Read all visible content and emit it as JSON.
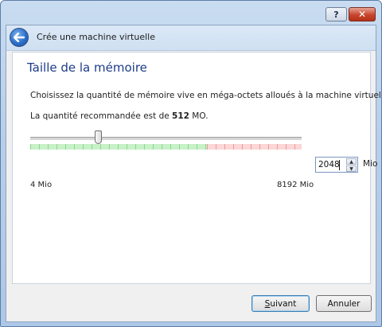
{
  "window": {
    "help_label": "?",
    "close_label": "✕"
  },
  "header": {
    "title": "Crée une machine virtuelle",
    "back_icon": "back-arrow-icon"
  },
  "page": {
    "title": "Taille de la mémoire",
    "description": "Choisissez la quantité de mémoire vive en méga-octets alloués à la machine virtuelle.",
    "recommended_prefix": "La quantité recommandée est de ",
    "recommended_value": "512",
    "recommended_suffix": " MO."
  },
  "memory": {
    "value": "2048",
    "unit": "Mio",
    "min_label": "4 Mio",
    "max_label": "8192 Mio",
    "slider_level": 0.25,
    "recommended_limit_fraction": 0.65,
    "zone_colors": {
      "ok": "#8bd98b",
      "warn": "#f19a9a"
    }
  },
  "buttons": {
    "next_first": "S",
    "next_rest": "uivant",
    "cancel": "Annuler"
  }
}
